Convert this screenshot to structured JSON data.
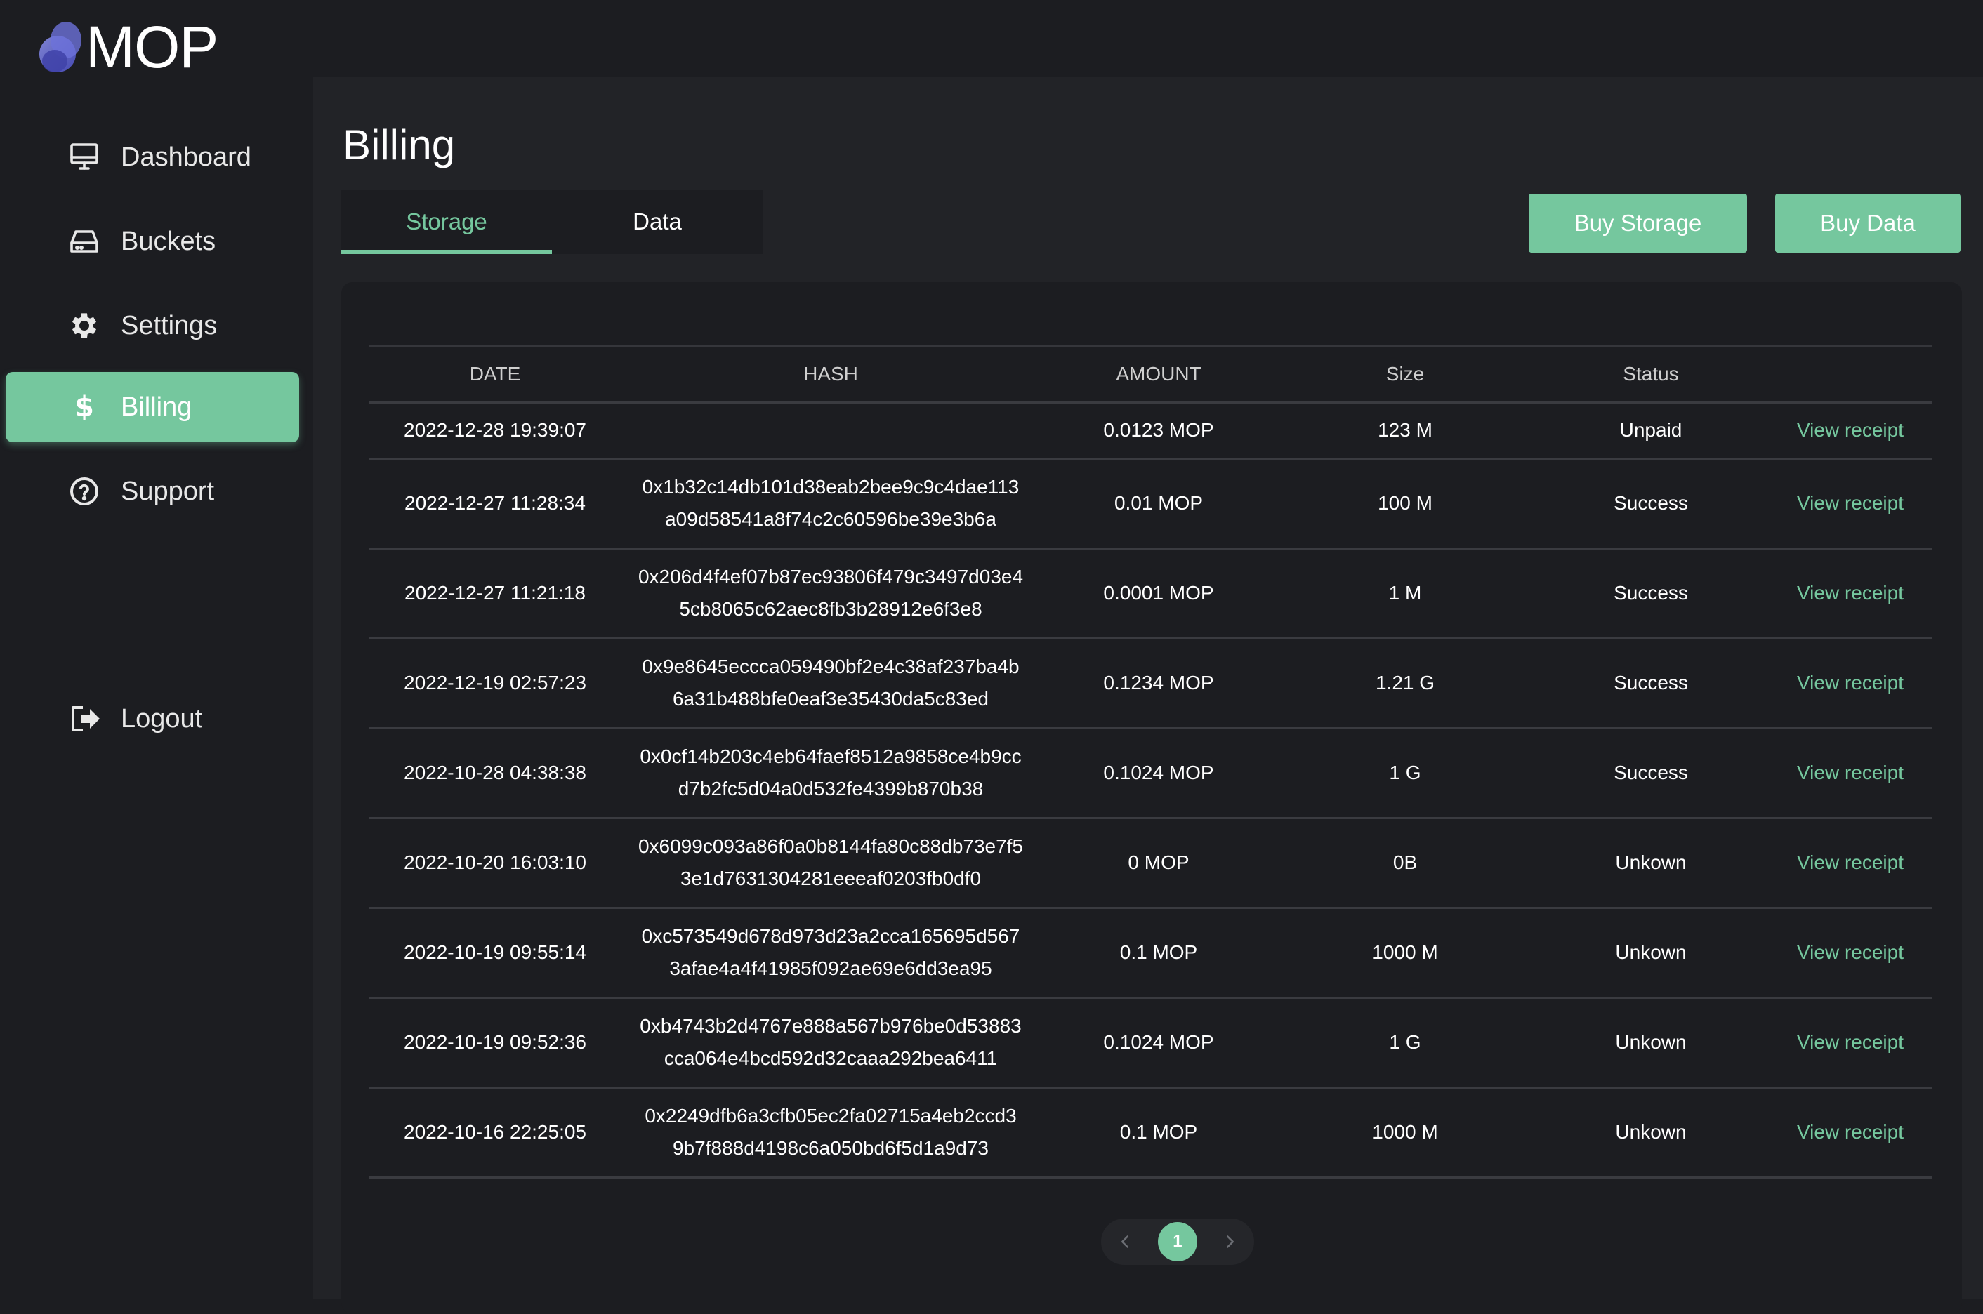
{
  "app": {
    "name": "MOP"
  },
  "colors": {
    "accent": "#75c79e",
    "background": "#1c1d21",
    "panel": "#222327"
  },
  "sidebar": {
    "items": [
      {
        "label": "Dashboard",
        "icon": "monitor-icon"
      },
      {
        "label": "Buckets",
        "icon": "drive-icon"
      },
      {
        "label": "Settings",
        "icon": "gear-icon"
      },
      {
        "label": "Billing",
        "icon": "dollar-icon",
        "active": true
      },
      {
        "label": "Support",
        "icon": "help-circle-icon"
      }
    ],
    "logout": {
      "label": "Logout",
      "icon": "logout-icon"
    }
  },
  "page": {
    "title": "Billing"
  },
  "tabs": [
    {
      "label": "Storage",
      "active": true
    },
    {
      "label": "Data"
    }
  ],
  "actions": {
    "buy_storage": "Buy Storage",
    "buy_data": "Buy Data"
  },
  "table": {
    "headers": [
      "DATE",
      "HASH",
      "AMOUNT",
      "Size",
      "Status",
      ""
    ],
    "rows": [
      {
        "date": "2022-12-28 19:39:07",
        "hash1": "",
        "hash2": "",
        "amount": "0.0123 MOP",
        "size": "123 M",
        "status": "Unpaid",
        "action": "View receipt"
      },
      {
        "date": "2022-12-27 11:28:34",
        "hash1": "0x1b32c14db101d38eab2bee9c9c4dae113",
        "hash2": "a09d58541a8f74c2c60596be39e3b6a",
        "amount": "0.01 MOP",
        "size": "100 M",
        "status": "Success",
        "action": "View receipt"
      },
      {
        "date": "2022-12-27 11:21:18",
        "hash1": "0x206d4f4ef07b87ec93806f479c3497d03e4",
        "hash2": "5cb8065c62aec8fb3b28912e6f3e8",
        "amount": "0.0001 MOP",
        "size": "1 M",
        "status": "Success",
        "action": "View receipt"
      },
      {
        "date": "2022-12-19 02:57:23",
        "hash1": "0x9e8645eccca059490bf2e4c38af237ba4b",
        "hash2": "6a31b488bfe0eaf3e35430da5c83ed",
        "amount": "0.1234 MOP",
        "size": "1.21 G",
        "status": "Success",
        "action": "View receipt"
      },
      {
        "date": "2022-10-28 04:38:38",
        "hash1": "0x0cf14b203c4eb64faef8512a9858ce4b9cc",
        "hash2": "d7b2fc5d04a0d532fe4399b870b38",
        "amount": "0.1024 MOP",
        "size": "1 G",
        "status": "Success",
        "action": "View receipt"
      },
      {
        "date": "2022-10-20 16:03:10",
        "hash1": "0x6099c093a86f0a0b8144fa80c88db73e7f5",
        "hash2": "3e1d7631304281eeeaf0203fb0df0",
        "amount": "0 MOP",
        "size": "0B",
        "status": "Unkown",
        "action": "View receipt"
      },
      {
        "date": "2022-10-19 09:55:14",
        "hash1": "0xc573549d678d973d23a2cca165695d567",
        "hash2": "3afae4a4f41985f092ae69e6dd3ea95",
        "amount": "0.1 MOP",
        "size": "1000 M",
        "status": "Unkown",
        "action": "View receipt"
      },
      {
        "date": "2022-10-19 09:52:36",
        "hash1": "0xb4743b2d4767e888a567b976be0d53883",
        "hash2": "cca064e4bcd592d32caaa292bea6411",
        "amount": "0.1024 MOP",
        "size": "1 G",
        "status": "Unkown",
        "action": "View receipt"
      },
      {
        "date": "2022-10-16 22:25:05",
        "hash1": "0x2249dfb6a3cfb05ec2fa02715a4eb2ccd3",
        "hash2": "9b7f888d4198c6a050bd6f5d1a9d73",
        "amount": "0.1 MOP",
        "size": "1000 M",
        "status": "Unkown",
        "action": "View receipt"
      }
    ]
  },
  "pagination": {
    "current": "1",
    "prev_icon": "chevron-left-icon",
    "next_icon": "chevron-right-icon"
  }
}
